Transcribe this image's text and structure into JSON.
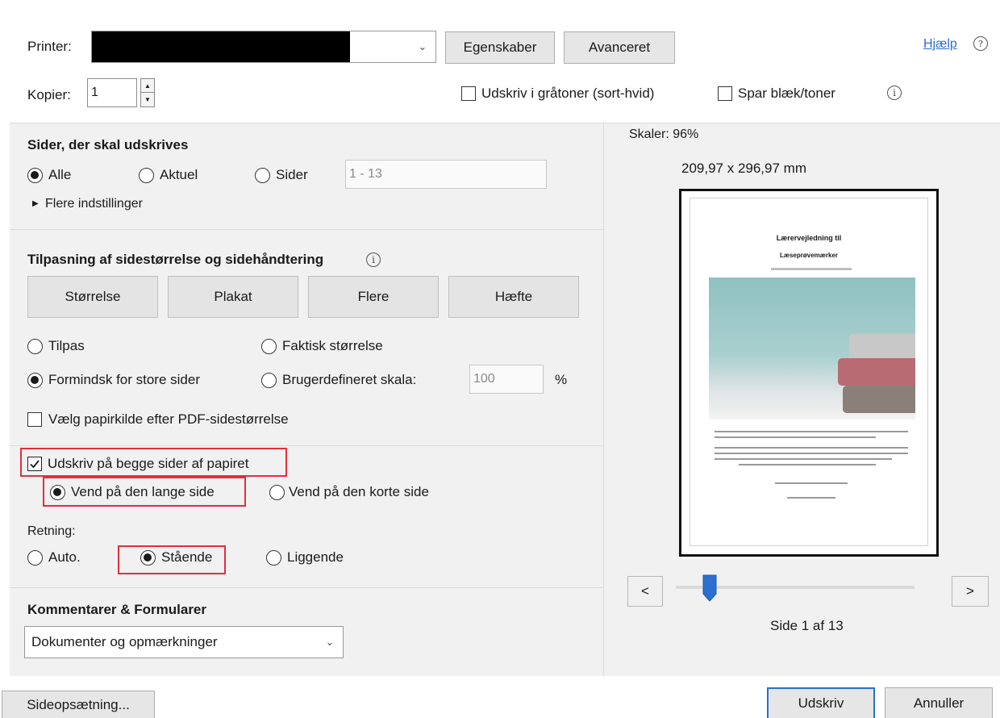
{
  "printer": {
    "label": "Printer:",
    "properties_button": "Egenskaber",
    "advanced_button": "Avanceret"
  },
  "help": {
    "label": "Hjælp"
  },
  "copies": {
    "label": "Kopier:",
    "value": "1"
  },
  "options": {
    "grayscale": "Udskriv i gråtoner (sort-hvid)",
    "save_ink": "Spar blæk/toner"
  },
  "pages": {
    "heading": "Sider, der skal udskrives",
    "all": "Alle",
    "current": "Aktuel",
    "pages": "Sider",
    "range_value": "1 - 13",
    "more_settings": "Flere indstillinger"
  },
  "sizing": {
    "heading": "Tilpasning af sidestørrelse og sidehåndtering",
    "size_button": "Størrelse",
    "poster_button": "Plakat",
    "multiple_button": "Flere",
    "booklet_button": "Hæfte",
    "fit": "Tilpas",
    "actual_size": "Faktisk størrelse",
    "shrink": "Formindsk for store sider",
    "custom_scale": "Brugerdefineret skala:",
    "custom_scale_value": "100",
    "percent": "%",
    "paper_source": "Vælg papirkilde efter PDF-sidestørrelse"
  },
  "duplex": {
    "both_sides": "Udskriv på begge sider af papiret",
    "long_edge": "Vend på den lange side",
    "short_edge": "Vend på den korte side"
  },
  "orientation": {
    "label": "Retning:",
    "auto": "Auto.",
    "portrait": "Stående",
    "landscape": "Liggende"
  },
  "comments": {
    "heading": "Kommentarer & Formularer",
    "value": "Dokumenter og opmærkninger"
  },
  "preview": {
    "scale": "Skaler:  96%",
    "dimensions": "209,97 x 296,97 mm",
    "doc_title_1": "Lærervejledning til",
    "doc_title_2": "Læseprøvemærker",
    "prev": "<",
    "next": ">",
    "page_status": "Side 1 af 13"
  },
  "footer": {
    "page_setup": "Sideopsætning...",
    "print": "Udskriv",
    "cancel": "Annuller"
  },
  "colors": {
    "accent_blue": "#2c6fd0",
    "highlight_red": "#e0303a",
    "panel": "#f1f1f1"
  }
}
